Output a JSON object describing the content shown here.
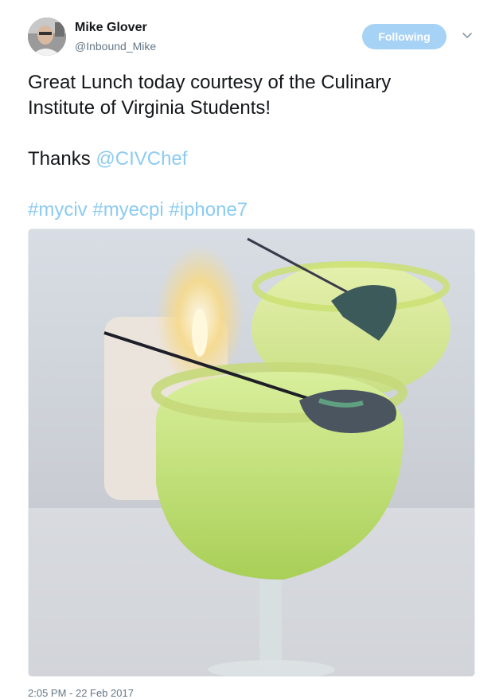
{
  "author": {
    "name": "Mike Glover",
    "handle": "@Inbound_Mike"
  },
  "follow_button": {
    "label": "Following"
  },
  "icons": {
    "menu": "chevron-down-icon"
  },
  "tweet": {
    "line1": "Great Lunch today courtesy of the Culinary",
    "line2": "Institute of Virginia Students!",
    "thanks_prefix": "Thanks ",
    "mention": "@CIVChef",
    "hashtags": [
      "#myciv",
      "#myecpi",
      "#iphone7"
    ]
  },
  "timestamp": "2:05 PM - 22 Feb 2017",
  "colors": {
    "link": "#8ccbf2",
    "follow_button_bg": "#a6d2f5",
    "secondary_text": "#657786"
  }
}
